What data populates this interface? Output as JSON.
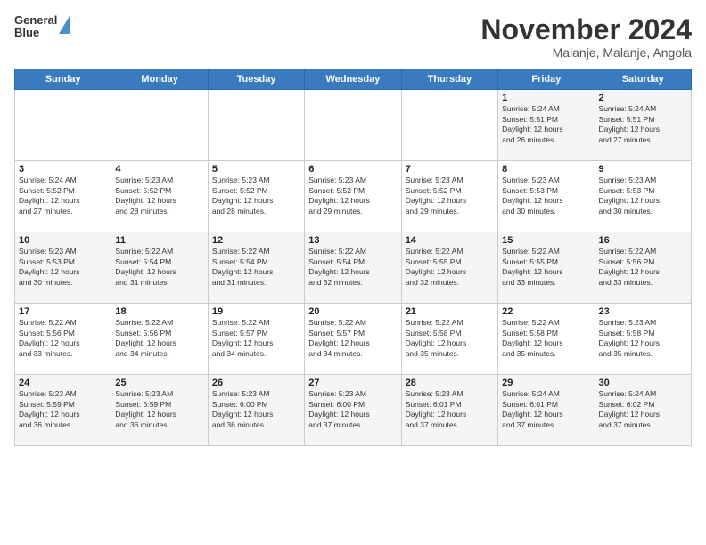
{
  "header": {
    "logo_line1": "General",
    "logo_line2": "Blue",
    "title": "November 2024",
    "subtitle": "Malanje, Malanje, Angola"
  },
  "days_of_week": [
    "Sunday",
    "Monday",
    "Tuesday",
    "Wednesday",
    "Thursday",
    "Friday",
    "Saturday"
  ],
  "weeks": [
    [
      {
        "day": "",
        "info": ""
      },
      {
        "day": "",
        "info": ""
      },
      {
        "day": "",
        "info": ""
      },
      {
        "day": "",
        "info": ""
      },
      {
        "day": "",
        "info": ""
      },
      {
        "day": "1",
        "info": "Sunrise: 5:24 AM\nSunset: 5:51 PM\nDaylight: 12 hours\nand 26 minutes."
      },
      {
        "day": "2",
        "info": "Sunrise: 5:24 AM\nSunset: 5:51 PM\nDaylight: 12 hours\nand 27 minutes."
      }
    ],
    [
      {
        "day": "3",
        "info": "Sunrise: 5:24 AM\nSunset: 5:52 PM\nDaylight: 12 hours\nand 27 minutes."
      },
      {
        "day": "4",
        "info": "Sunrise: 5:23 AM\nSunset: 5:52 PM\nDaylight: 12 hours\nand 28 minutes."
      },
      {
        "day": "5",
        "info": "Sunrise: 5:23 AM\nSunset: 5:52 PM\nDaylight: 12 hours\nand 28 minutes."
      },
      {
        "day": "6",
        "info": "Sunrise: 5:23 AM\nSunset: 5:52 PM\nDaylight: 12 hours\nand 29 minutes."
      },
      {
        "day": "7",
        "info": "Sunrise: 5:23 AM\nSunset: 5:52 PM\nDaylight: 12 hours\nand 29 minutes."
      },
      {
        "day": "8",
        "info": "Sunrise: 5:23 AM\nSunset: 5:53 PM\nDaylight: 12 hours\nand 30 minutes."
      },
      {
        "day": "9",
        "info": "Sunrise: 5:23 AM\nSunset: 5:53 PM\nDaylight: 12 hours\nand 30 minutes."
      }
    ],
    [
      {
        "day": "10",
        "info": "Sunrise: 5:23 AM\nSunset: 5:53 PM\nDaylight: 12 hours\nand 30 minutes."
      },
      {
        "day": "11",
        "info": "Sunrise: 5:22 AM\nSunset: 5:54 PM\nDaylight: 12 hours\nand 31 minutes."
      },
      {
        "day": "12",
        "info": "Sunrise: 5:22 AM\nSunset: 5:54 PM\nDaylight: 12 hours\nand 31 minutes."
      },
      {
        "day": "13",
        "info": "Sunrise: 5:22 AM\nSunset: 5:54 PM\nDaylight: 12 hours\nand 32 minutes."
      },
      {
        "day": "14",
        "info": "Sunrise: 5:22 AM\nSunset: 5:55 PM\nDaylight: 12 hours\nand 32 minutes."
      },
      {
        "day": "15",
        "info": "Sunrise: 5:22 AM\nSunset: 5:55 PM\nDaylight: 12 hours\nand 33 minutes."
      },
      {
        "day": "16",
        "info": "Sunrise: 5:22 AM\nSunset: 5:56 PM\nDaylight: 12 hours\nand 33 minutes."
      }
    ],
    [
      {
        "day": "17",
        "info": "Sunrise: 5:22 AM\nSunset: 5:56 PM\nDaylight: 12 hours\nand 33 minutes."
      },
      {
        "day": "18",
        "info": "Sunrise: 5:22 AM\nSunset: 5:56 PM\nDaylight: 12 hours\nand 34 minutes."
      },
      {
        "day": "19",
        "info": "Sunrise: 5:22 AM\nSunset: 5:57 PM\nDaylight: 12 hours\nand 34 minutes."
      },
      {
        "day": "20",
        "info": "Sunrise: 5:22 AM\nSunset: 5:57 PM\nDaylight: 12 hours\nand 34 minutes."
      },
      {
        "day": "21",
        "info": "Sunrise: 5:22 AM\nSunset: 5:58 PM\nDaylight: 12 hours\nand 35 minutes."
      },
      {
        "day": "22",
        "info": "Sunrise: 5:22 AM\nSunset: 5:58 PM\nDaylight: 12 hours\nand 35 minutes."
      },
      {
        "day": "23",
        "info": "Sunrise: 5:23 AM\nSunset: 5:58 PM\nDaylight: 12 hours\nand 35 minutes."
      }
    ],
    [
      {
        "day": "24",
        "info": "Sunrise: 5:23 AM\nSunset: 5:59 PM\nDaylight: 12 hours\nand 36 minutes."
      },
      {
        "day": "25",
        "info": "Sunrise: 5:23 AM\nSunset: 5:59 PM\nDaylight: 12 hours\nand 36 minutes."
      },
      {
        "day": "26",
        "info": "Sunrise: 5:23 AM\nSunset: 6:00 PM\nDaylight: 12 hours\nand 36 minutes."
      },
      {
        "day": "27",
        "info": "Sunrise: 5:23 AM\nSunset: 6:00 PM\nDaylight: 12 hours\nand 37 minutes."
      },
      {
        "day": "28",
        "info": "Sunrise: 5:23 AM\nSunset: 6:01 PM\nDaylight: 12 hours\nand 37 minutes."
      },
      {
        "day": "29",
        "info": "Sunrise: 5:24 AM\nSunset: 6:01 PM\nDaylight: 12 hours\nand 37 minutes."
      },
      {
        "day": "30",
        "info": "Sunrise: 5:24 AM\nSunset: 6:02 PM\nDaylight: 12 hours\nand 37 minutes."
      }
    ]
  ]
}
